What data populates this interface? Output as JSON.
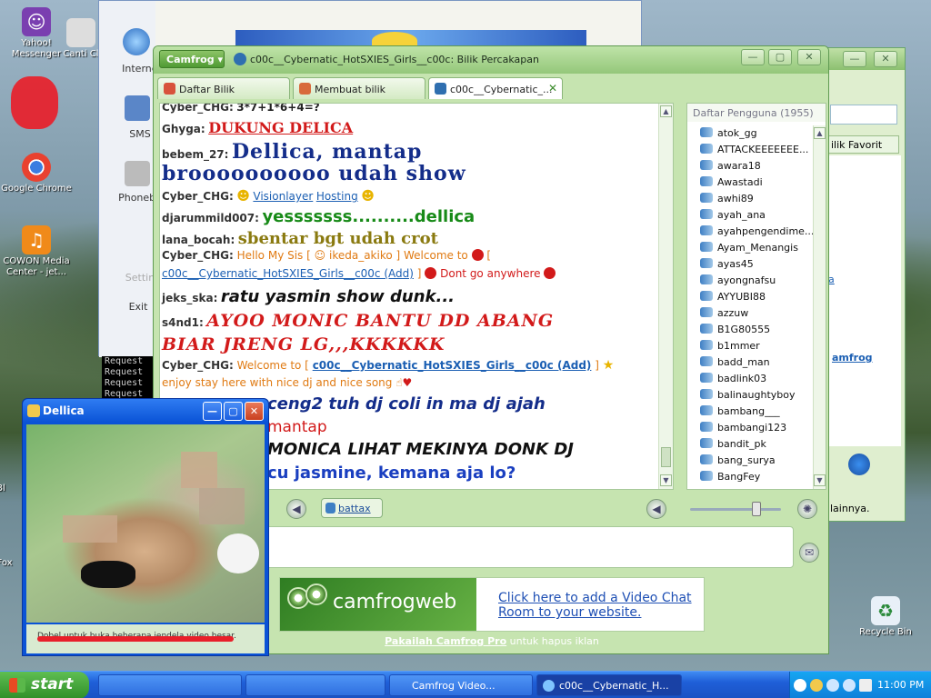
{
  "desktop": {
    "icons": [
      {
        "label": "Yahoo!\nMessenger",
        "glyph": "☺"
      },
      {
        "label": "Google Chrome",
        "glyph": "◎"
      },
      {
        "label": "COWON Media Center - jet...",
        "glyph": "♫"
      },
      {
        "label": "Recycle Bin",
        "glyph": "♻"
      }
    ],
    "partial": [
      "Canti Cl",
      "Bl",
      "Fox"
    ]
  },
  "backwin": {
    "items": [
      "Internet",
      "SMS",
      "Phonebo",
      "Settin",
      "Exit"
    ]
  },
  "console": {
    "lines": [
      "Request",
      "Request",
      "Request",
      "Request"
    ]
  },
  "rightwin": {
    "favorit": "ilik Favorit",
    "link": "amfrog",
    "a": "a",
    "status": "lainnya."
  },
  "main": {
    "menu": "Camfrog",
    "title": "c00c__Cybernatic_HotSXIES_Girls__c00c: Bilik Percakapan",
    "tabs": [
      "Daftar Bilik",
      "Membuat bilik",
      "c00c__Cybernatic_..."
    ],
    "chat": [
      {
        "nick": "Cyber_CHG:",
        "text": "3*7+1*6+4=?",
        "color": "#222",
        "font": "Liberation Sans"
      },
      {
        "nick": "Ghyga:",
        "text": "DUKUNG DELICA",
        "color": "#d21a1a"
      },
      {
        "nick": "bebem_27:",
        "text": "Dellica, mantap",
        "color": "#142d8a"
      },
      {
        "nick": "",
        "text": "broooooooooo udah show",
        "color": "#142d8a"
      },
      {
        "nick": "Cyber_CHG:",
        "text": "Visionlayer",
        "text2": "Hosting",
        "color": "#1b5fb3"
      },
      {
        "nick": "djarummild007:",
        "text": "yesssssss..........dellica",
        "color": "#178a17"
      },
      {
        "nick": "lana_bocah:",
        "text": "sbentar bgt udah crot",
        "color": "#8a7a10"
      },
      {
        "nick": "Cyber_CHG:",
        "text": "Hello My Sis [",
        "text2": "ikeda_akiko ] Welcome to",
        "text3": "[",
        "color": "#e07a12"
      },
      {
        "nick": "",
        "text": "c00c__Cybernatic_HotSXIES_Girls__c00c (Add)",
        "text2": "]",
        "text3": "Dont go anywhere",
        "color": "#1b5fb3"
      },
      {
        "nick": "jeks_ska:",
        "text": "ratu yasmin show dunk...",
        "color": "#111"
      },
      {
        "nick": "s4nd1:",
        "text": "AYOO MONIC BANTU DD ABANG",
        "color": "#d21a1a"
      },
      {
        "nick": "",
        "text": "BIAR JRENG LG,,,KKKKKK",
        "color": "#d21a1a"
      },
      {
        "nick": "Cyber_CHG:",
        "text": "Welcome to [",
        "text2": "c00c__Cybernatic_HotSXIES_Girls__c00c (Add)",
        "text3": "]",
        "color": "#e07a12"
      },
      {
        "nick": "",
        "text": "enjoy stay here with nice dj and nice song",
        "color": "#e07a12"
      },
      {
        "nick": "",
        "text": "ceng2 tuh dj coli in ma dj ajah",
        "color": "#142d8a"
      },
      {
        "nick": "",
        "text": "mantap",
        "color": "#d21a1a"
      },
      {
        "nick": "",
        "text": "MONICA LIHAT MEKINYA DONK DJ",
        "color": "#111"
      },
      {
        "nick": "",
        "text": "cu jasmine, kemana aja lo?",
        "color": "#1a3fc0"
      }
    ],
    "users_header": "Daftar Pengguna (1955)",
    "users": [
      "atok_gg",
      "ATTACKEEEEEEE...",
      "awara18",
      "Awastadi",
      "awhi89",
      "ayah_ana",
      "ayahpengendime...",
      "Ayam_Menangis",
      "ayas45",
      "ayongnafsu",
      "AYYUBI88",
      "azzuw",
      "B1G80555",
      "b1mmer",
      "badd_man",
      "badlink03",
      "balinaughtyboy",
      "bambang___",
      "bambangi123",
      "bandit_pk",
      "bang_surya",
      "BangFey"
    ],
    "battax": "battax",
    "ad": {
      "brand": "camfrogweb",
      "line1": "Click here to add a Video Chat",
      "line2": "Room to your website."
    },
    "promo_link": "Pakailah Camfrog Pro",
    "promo_rest": " untuk hapus iklan"
  },
  "video": {
    "title": "Dellica",
    "status": "Dobel untuk buka beberapa jendela video besar."
  },
  "taskbar": {
    "start": "start",
    "items": [
      "",
      "",
      "Camfrog Video...",
      "c00c__Cybernatic_H..."
    ],
    "time": "11:00 PM"
  }
}
